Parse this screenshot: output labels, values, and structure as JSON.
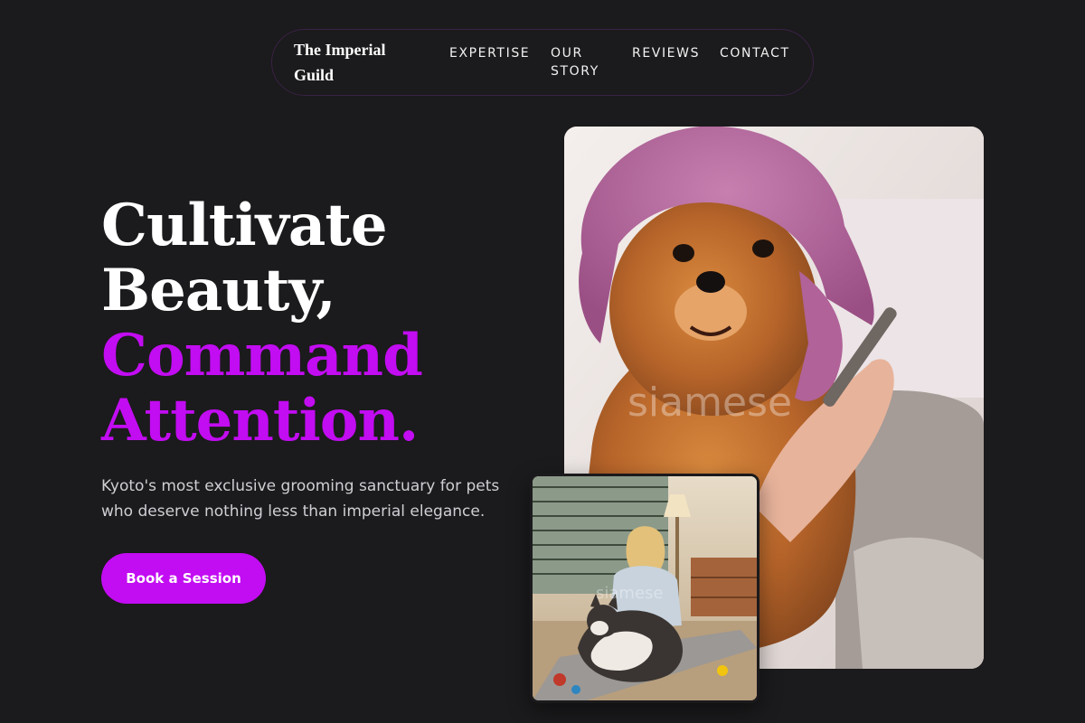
{
  "nav": {
    "brand": "The Imperial Guild",
    "links": [
      "EXPERTISE",
      "OUR STORY",
      "REVIEWS",
      "CONTACT"
    ]
  },
  "hero": {
    "title_lines": [
      "Cultivate",
      "Beauty,"
    ],
    "accent_lines": [
      "Command",
      "Attention."
    ],
    "subtitle": "Kyoto's most exclusive grooming sanctuary for pets who deserve nothing less than imperial elegance.",
    "cta_label": "Book a Session"
  },
  "images": {
    "main": {
      "watermark": "siamese"
    },
    "secondary": {
      "watermark": "siamese"
    }
  },
  "colors": {
    "background": "#1b1a1c",
    "accent": "#c20cf2",
    "text": "#ffffff",
    "muted_text": "#cfcfd4"
  }
}
